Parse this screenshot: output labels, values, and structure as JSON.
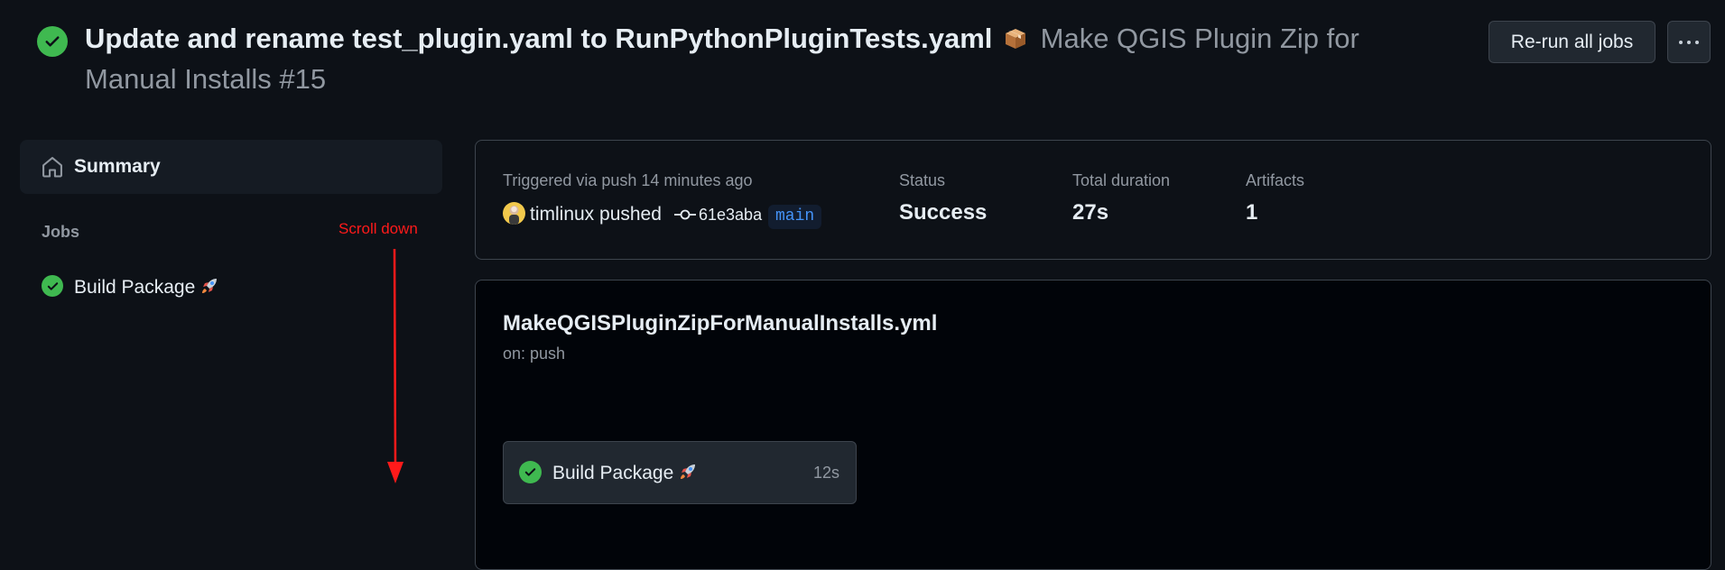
{
  "header": {
    "commit_title": "Update and rename test_plugin.yaml to RunPythonPluginTests.yaml",
    "workflow_title": "Make QGIS Plugin Zip for Manual Installs #15",
    "rerun_label": "Re-run all jobs",
    "more_icon": "kebab-horizontal-icon"
  },
  "sidebar": {
    "summary_label": "Summary",
    "jobs_heading": "Jobs",
    "jobs": [
      {
        "label": "Build Package"
      }
    ]
  },
  "annotation": {
    "text": "Scroll down",
    "color": "#ff1a1a"
  },
  "run_summary": {
    "trigger_text": "Triggered via push 14 minutes ago",
    "actor": "timlinux pushed",
    "commit_sha": "61e3aba",
    "branch": "main",
    "status_label": "Status",
    "status_value": "Success",
    "duration_label": "Total duration",
    "duration_value": "27s",
    "artifacts_label": "Artifacts",
    "artifacts_value": "1"
  },
  "workflow": {
    "file_name": "MakeQGISPluginZipForManualInstalls.yml",
    "trigger": "on: push",
    "job": {
      "label": "Build Package",
      "duration": "12s"
    }
  },
  "colors": {
    "background": "#0d1117",
    "success": "#3fb950",
    "link": "#4493f8",
    "border": "#3d444d"
  }
}
